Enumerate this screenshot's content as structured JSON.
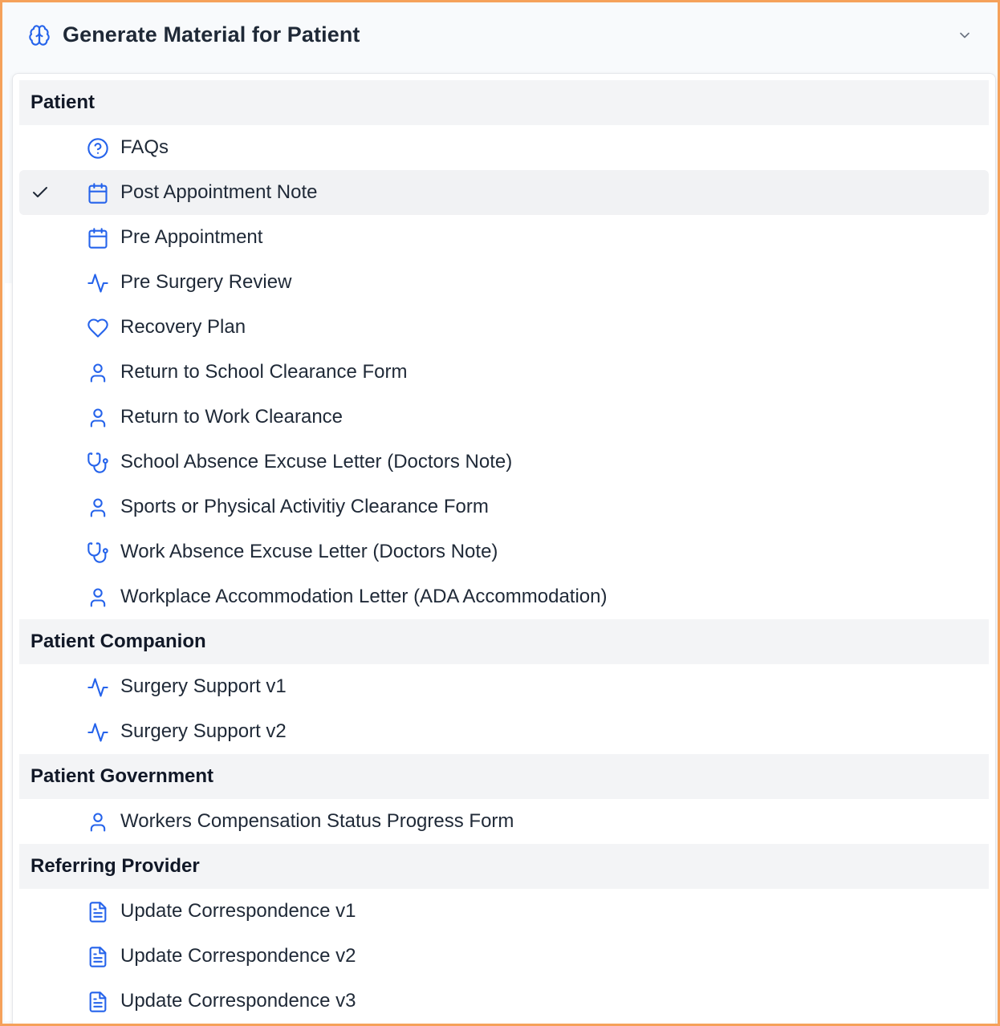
{
  "header": {
    "title": "Generate Material for Patient",
    "icon": "brain-icon",
    "toggle_icon": "chevron-down-icon"
  },
  "colors": {
    "accent": "#2563eb",
    "border": "#f5a15a",
    "group_bg": "#f3f4f6",
    "selected_bg": "#f1f2f4"
  },
  "groups": [
    {
      "label": "Patient",
      "items": [
        {
          "label": "FAQs",
          "icon": "help-circle-icon"
        },
        {
          "label": "Post Appointment Note",
          "icon": "calendar-icon",
          "selected": true
        },
        {
          "label": "Pre Appointment",
          "icon": "calendar-icon"
        },
        {
          "label": "Pre Surgery Review",
          "icon": "activity-icon"
        },
        {
          "label": "Recovery Plan",
          "icon": "heart-icon"
        },
        {
          "label": "Return to School Clearance Form",
          "icon": "user-icon"
        },
        {
          "label": "Return to Work Clearance",
          "icon": "user-icon"
        },
        {
          "label": "School Absence Excuse Letter (Doctors Note)",
          "icon": "stethoscope-icon"
        },
        {
          "label": "Sports or Physical Activitiy Clearance Form",
          "icon": "user-icon"
        },
        {
          "label": "Work Absence Excuse Letter (Doctors Note)",
          "icon": "stethoscope-icon"
        },
        {
          "label": "Workplace Accommodation Letter (ADA Accommodation)",
          "icon": "user-icon"
        }
      ]
    },
    {
      "label": "Patient Companion",
      "items": [
        {
          "label": "Surgery Support v1",
          "icon": "activity-icon"
        },
        {
          "label": "Surgery Support v2",
          "icon": "activity-icon"
        }
      ]
    },
    {
      "label": "Patient Government",
      "items": [
        {
          "label": "Workers Compensation Status Progress Form",
          "icon": "user-icon"
        }
      ]
    },
    {
      "label": "Referring Provider",
      "items": [
        {
          "label": "Update Correspondence v1",
          "icon": "file-text-icon"
        },
        {
          "label": "Update Correspondence v2",
          "icon": "file-text-icon"
        },
        {
          "label": "Update Correspondence v3",
          "icon": "file-text-icon"
        }
      ]
    }
  ]
}
